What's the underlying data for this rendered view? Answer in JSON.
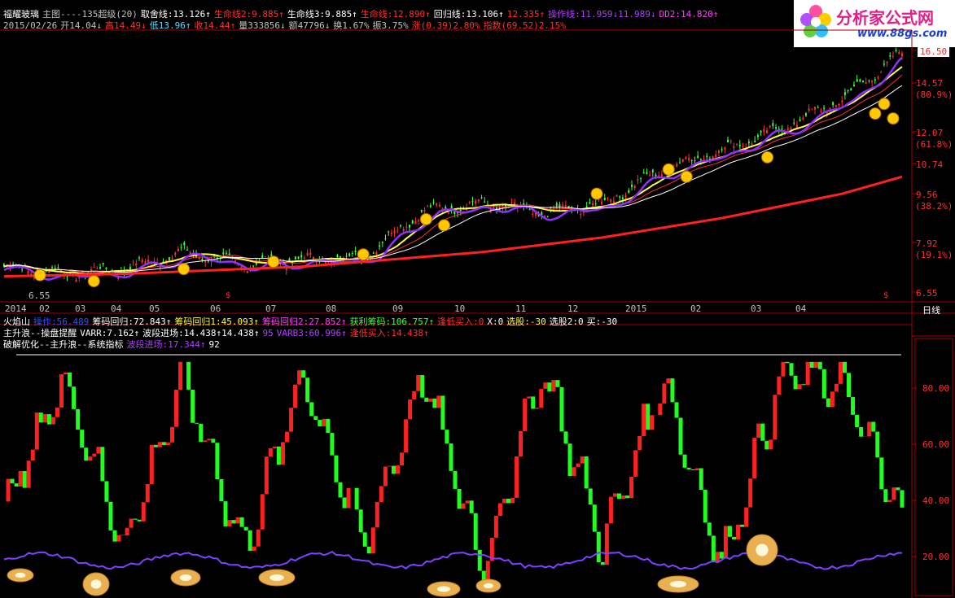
{
  "header": {
    "line1": [
      {
        "text": "福耀玻璃",
        "color": "#ffffff"
      },
      {
        "text": "主图----135超级(20)",
        "color": "#c0c0c0"
      },
      {
        "text": "取舍线:13.126↑",
        "color": "#ffffff"
      },
      {
        "text": "生命线2:9.885↑",
        "color": "#ff3030"
      },
      {
        "text": "生命线3:9.885↑",
        "color": "#ffffff"
      },
      {
        "text": "生命线:12.890↑",
        "color": "#ff3030"
      },
      {
        "text": "回归线:13.106↑",
        "color": "#ffffff"
      },
      {
        "text": "12.335↑",
        "color": "#ff3030"
      },
      {
        "text": "操作线:11.959↓11.989↓",
        "color": "#b040ff"
      },
      {
        "text": "DD2:14.820↑",
        "color": "#ff40ff"
      }
    ],
    "line2": [
      {
        "text": "2015/02/26",
        "color": "#c0c0c0"
      },
      {
        "text": "开14.04↓",
        "color": "#c0c0c0"
      },
      {
        "text": "高14.49↓",
        "color": "#ff3030"
      },
      {
        "text": "低13.96↑",
        "color": "#50e0ff"
      },
      {
        "text": "收14.44↑",
        "color": "#ff3030"
      },
      {
        "text": "量333856↓",
        "color": "#c0c0c0"
      },
      {
        "text": "额47796↓",
        "color": "#c0c0c0"
      },
      {
        "text": "换1.67%",
        "color": "#c0c0c0"
      },
      {
        "text": "振3.75%",
        "color": "#c0c0c0"
      },
      {
        "text": "涨(0.39)2.80%",
        "color": "#ff3030"
      },
      {
        "text": "指数(69.52)2.15%",
        "color": "#ff3030"
      }
    ]
  },
  "logo": {
    "title": "分析家公式网",
    "url": "www.88gs.com"
  },
  "price_labels": [
    {
      "text": "16.50",
      "highlight": true
    },
    {
      "text": "14.57"
    },
    {
      "text": "(80.9%)"
    },
    {
      "text": "12.07"
    },
    {
      "text": "(61.8%)"
    },
    {
      "text": "10.74"
    },
    {
      "text": "9.56"
    },
    {
      "text": "(38.2%)"
    },
    {
      "text": "7.92"
    },
    {
      "text": "(19.1%)"
    },
    {
      "text": "6.55"
    }
  ],
  "low_marker": "6.55",
  "month_axis": [
    "2014",
    "02",
    "03",
    "04",
    "05",
    "06",
    "07",
    "08",
    "09",
    "10",
    "11",
    "12",
    "2015",
    "02",
    "03",
    "04"
  ],
  "period_label": "日线",
  "indicator_lines": {
    "line1": [
      {
        "text": "火焰山",
        "color": "#ffffff"
      },
      {
        "text": "操作:56.489",
        "color": "#3050ff"
      },
      {
        "text": "筹码回归:72.843↑",
        "color": "#ffffff"
      },
      {
        "text": "筹码回归1:45.093↑",
        "color": "#ffff40"
      },
      {
        "text": "筹码回归2:27.852↑",
        "color": "#ff40ff"
      },
      {
        "text": "获利筹码:106.757↑",
        "color": "#40ff40"
      },
      {
        "text": "逢低买入:0",
        "color": "#ff3030"
      },
      {
        "text": "X:0",
        "color": "#ffffff"
      },
      {
        "text": "选股:-30",
        "color": "#ffff40"
      },
      {
        "text": "选股2:0",
        "color": "#ffffff"
      },
      {
        "text": "买:-30",
        "color": "#ffffff"
      }
    ],
    "line2": [
      {
        "text": "主升浪--操盘提醒",
        "color": "#ffffff"
      },
      {
        "text": "VARR:7.162↑",
        "color": "#ffffff"
      },
      {
        "text": "波段进场:14.438↑14.438↑",
        "color": "#ffffff"
      },
      {
        "text": "95",
        "color": "#b040ff"
      },
      {
        "text": "VARB3:60.996↑",
        "color": "#b040ff"
      },
      {
        "text": "逢低买入:14.438↑",
        "color": "#ff3030"
      }
    ],
    "line3": [
      {
        "text": "破解优化--主升浪--系统指标",
        "color": "#ffffff"
      },
      {
        "text": "波段进场:17.344↑",
        "color": "#b040ff"
      },
      {
        "text": "92",
        "color": "#ffffff"
      }
    ]
  },
  "osc_labels": [
    "80.00",
    "60.00",
    "40.00",
    "20.00"
  ],
  "chart_data": {
    "type": "line",
    "title": "福耀玻璃",
    "price_ylim": [
      6.55,
      16.5
    ],
    "osc_ylim": [
      0,
      100
    ],
    "x": [
      "2014",
      "02",
      "03",
      "04",
      "05",
      "06",
      "07",
      "08",
      "09",
      "10",
      "11",
      "12",
      "2015",
      "02",
      "03",
      "04"
    ],
    "series": [
      {
        "name": "price",
        "values": [
          7.6,
          7.3,
          7.5,
          8.2,
          7.7,
          7.9,
          8.0,
          9.9,
          10.2,
          9.8,
          10.2,
          11.6,
          12.4,
          13.3,
          14.5,
          16.4
        ]
      },
      {
        "name": "生命线2",
        "values": [
          7.2,
          7.25,
          7.3,
          7.4,
          7.5,
          7.6,
          7.8,
          8.0,
          8.2,
          8.5,
          8.8,
          9.2,
          9.6,
          10.1,
          10.6,
          11.3
        ]
      },
      {
        "name": "oscillator",
        "values": [
          35,
          90,
          20,
          90,
          18,
          92,
          20,
          92,
          10,
          95,
          20,
          90,
          12,
          92,
          88,
          30
        ]
      }
    ],
    "grid": true
  }
}
